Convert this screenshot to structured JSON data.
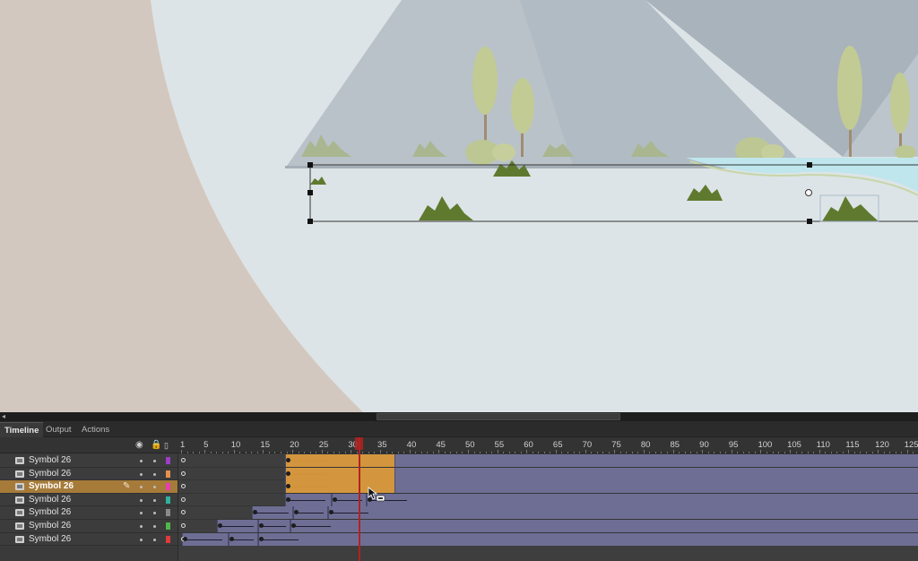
{
  "stage": {
    "background_color": "#dde4e7",
    "pasteboard_color": "#d3c8bf",
    "mountain_color": "#b3bcc4",
    "tree_color": "#c2cb93",
    "grass_color": "#5f7a2e",
    "water_color": "#bfe6ec"
  },
  "panel": {
    "tabs": [
      {
        "label": "Timeline",
        "active": true
      },
      {
        "label": "Output",
        "active": false
      },
      {
        "label": "Actions",
        "active": false
      }
    ]
  },
  "timeline": {
    "header_icons": [
      "eye-icon",
      "lock-icon",
      "outline-icon"
    ],
    "frame_numbers": [
      "1",
      "5",
      "10",
      "15",
      "20",
      "25",
      "30",
      "35",
      "40",
      "45",
      "50",
      "55",
      "60",
      "65",
      "70",
      "75",
      "80",
      "85",
      "90",
      "95",
      "100",
      "105",
      "110",
      "115",
      "120",
      "125"
    ],
    "current_frame": 33,
    "layers": [
      {
        "name": "Symbol 26",
        "color": "#9b3fc6",
        "selected": false
      },
      {
        "name": "Symbol 26",
        "color": "#e5914d",
        "selected": false
      },
      {
        "name": "Symbol 26",
        "color": "#e63fb0",
        "selected": true
      },
      {
        "name": "Symbol 26",
        "color": "#2fb3a0",
        "selected": false
      },
      {
        "name": "Symbol 26",
        "color": "#8a8a8a",
        "selected": false
      },
      {
        "name": "Symbol 26",
        "color": "#4fb84a",
        "selected": false
      },
      {
        "name": "Symbol 26",
        "color": "#e03b3b",
        "selected": false
      }
    ]
  }
}
